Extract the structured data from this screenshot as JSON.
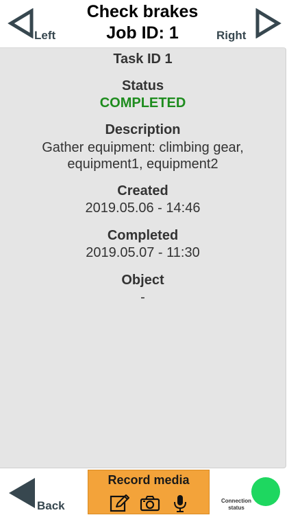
{
  "header": {
    "title": "Check brakes",
    "job_id_text": "Job ID: 1",
    "left_label": "Left",
    "right_label": "Right"
  },
  "task": {
    "task_id_text": "Task ID 1",
    "status_title": "Status",
    "status_value": "COMPLETED",
    "description_title": "Description",
    "description_value": "Gather equipment: climbing gear, equipment1, equipment2",
    "created_title": "Created",
    "created_value": "2019.05.06 - 14:46",
    "completed_title": "Completed",
    "completed_value": "2019.05.07 - 11:30",
    "object_title": "Object",
    "object_value": "-"
  },
  "footer": {
    "back_label": "Back",
    "record_media_label": "Record media",
    "media_icons": [
      "edit-icon",
      "camera-icon",
      "microphone-icon"
    ],
    "connection_status_label": "Connection status",
    "connection_status_color": "#1ed760"
  },
  "colors": {
    "status_completed": "#1e8c1e",
    "record_media_bg": "#f3a33a",
    "nav_arrow": "#37474f",
    "panel_bg": "#e5e5e5"
  }
}
